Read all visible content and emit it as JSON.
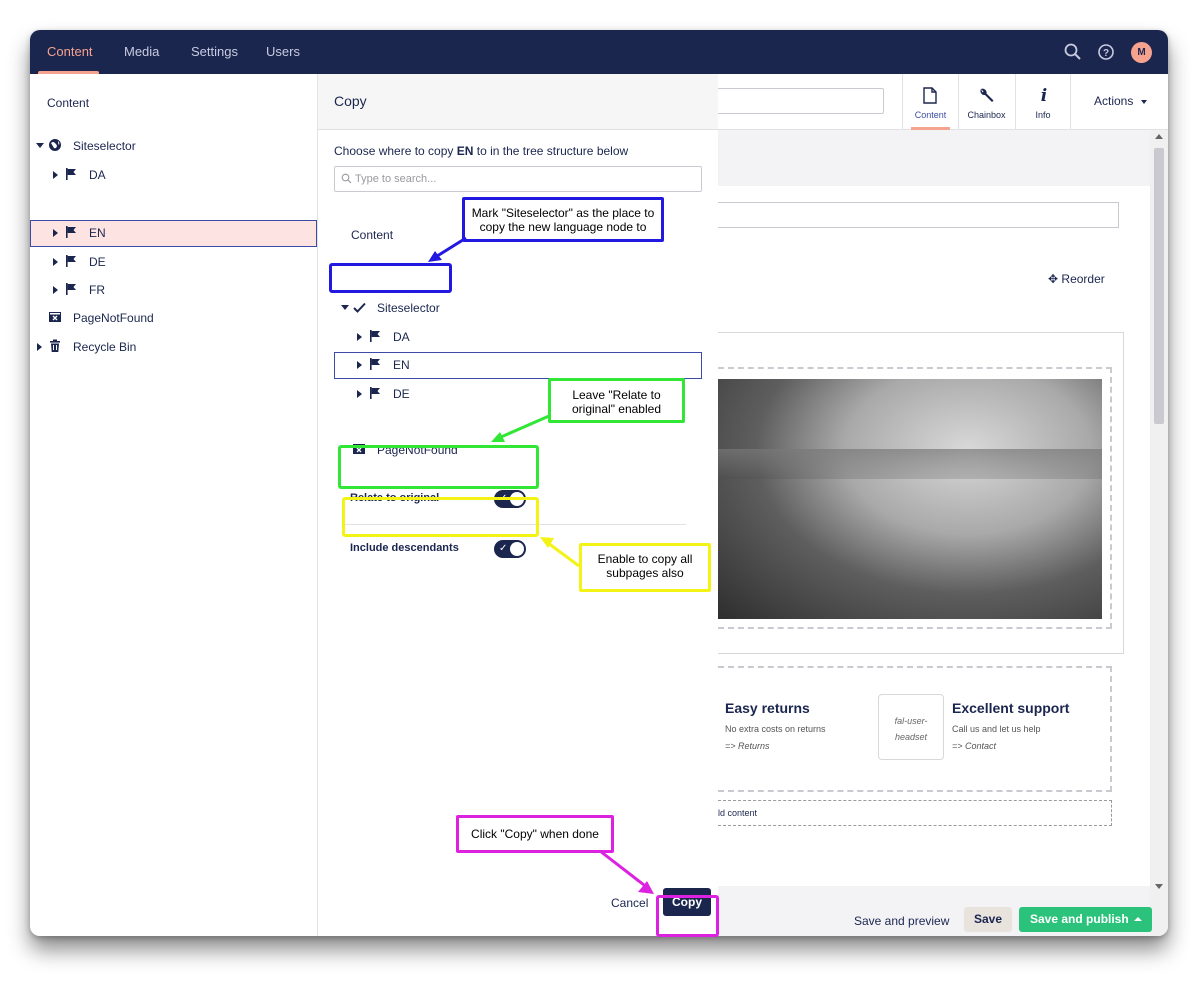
{
  "top_nav": {
    "items": [
      "Content",
      "Media",
      "Settings",
      "Users"
    ],
    "avatar_initial": "M",
    "icons": [
      "search-icon",
      "help-icon"
    ]
  },
  "sidebar": {
    "title": "Content",
    "tree": [
      {
        "label": "Siteselector",
        "icon": "globe-icon"
      },
      {
        "label": "DA",
        "icon": "flag-icon"
      },
      {
        "label": "EN",
        "icon": "flag-icon",
        "selected": true
      },
      {
        "label": "DE",
        "icon": "flag-icon"
      },
      {
        "label": "FR",
        "icon": "flag-icon"
      },
      {
        "label": "PageNotFound",
        "icon": "page-not-found-icon"
      },
      {
        "label": "Recycle Bin",
        "icon": "trash-icon"
      }
    ]
  },
  "dialog": {
    "title": "Copy",
    "description_prefix": "Choose where to copy ",
    "description_bold": "EN",
    "description_suffix": " to in the tree structure below",
    "search_placeholder": "Type to search...",
    "tree_root": "Content",
    "tree": [
      {
        "label": "Siteselector"
      },
      {
        "label": "DA"
      },
      {
        "label": "EN"
      },
      {
        "label": "DE"
      },
      {
        "label": "PageNotFound"
      }
    ],
    "relate_label": "Relate to original",
    "relate_enabled": true,
    "descendants_label": "Include descendants",
    "descendants_enabled": true,
    "cancel_label": "Cancel",
    "copy_label": "Copy"
  },
  "editor": {
    "apps": [
      {
        "label": "Content",
        "icon": "document-icon",
        "active": true
      },
      {
        "label": "Chainbox",
        "icon": "wrench-icon"
      },
      {
        "label": "Info",
        "icon": "info-icon"
      }
    ],
    "actions_label": "Actions",
    "reorder_label": "Reorder",
    "features": [
      {
        "title": "Easy returns",
        "subtitle": "No extra costs on returns",
        "link": "=> Returns"
      },
      {
        "title": "Excellent support",
        "subtitle": "Call us and let us help",
        "link": "=> Contact"
      }
    ],
    "feature_icon_text": "fal-user-headset",
    "add_content_label": "ld content",
    "save_preview_label": "Save and preview",
    "save_label": "Save",
    "publish_label": "Save and publish"
  },
  "annotations": {
    "mark": "Mark \"Siteselector\" as the place to copy the new language node to",
    "relate": "Leave \"Relate to original\" enabled",
    "descendants": "Enable to copy all subpages also",
    "copy": "Click \"Copy\" when done"
  },
  "colors": {
    "topbar": "#1b264f",
    "accent": "#f5a28f",
    "annotation_blue": "#2219e0",
    "annotation_green": "#31e634",
    "annotation_yellow": "#f3f315",
    "annotation_magenta": "#dc22e0",
    "publish": "#2bc37c"
  }
}
